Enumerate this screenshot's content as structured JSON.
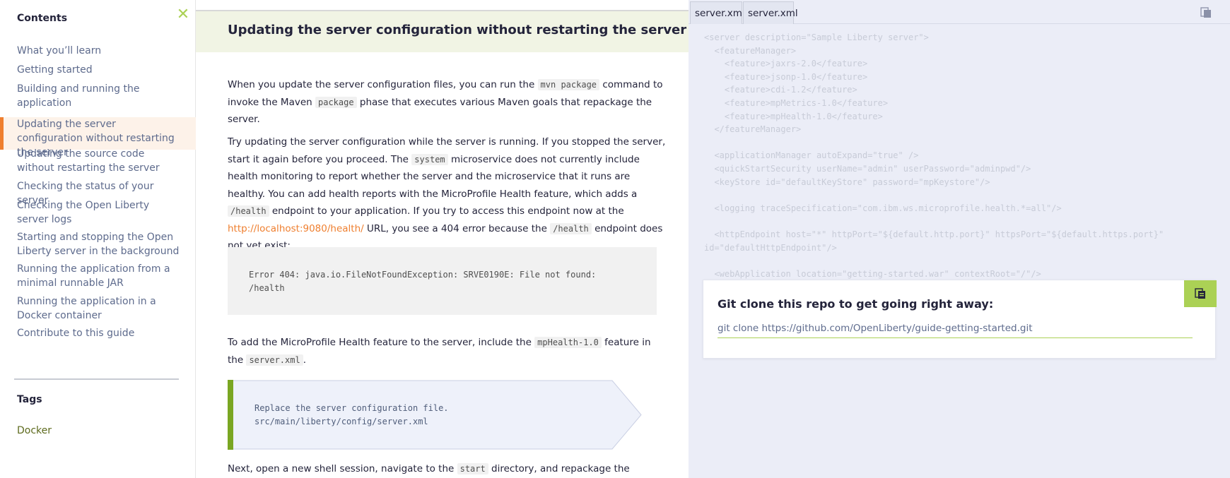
{
  "sidebar": {
    "title": "Contents",
    "toc": [
      {
        "label": "What you’ll learn"
      },
      {
        "label": "Getting started"
      },
      {
        "label": "Building and running the application"
      },
      {
        "label": "Updating the server configuration without restarting the server"
      },
      {
        "label": "Updating the source code without restarting the server"
      },
      {
        "label": "Checking the status of your server"
      },
      {
        "label": "Checking the Open Liberty server logs"
      },
      {
        "label": "Starting and stopping the Open Liberty server in the background"
      },
      {
        "label": "Running the application from a minimal runnable JAR"
      },
      {
        "label": "Running the application in a Docker container"
      },
      {
        "label": "Contribute to this guide"
      }
    ],
    "active_index": 3,
    "tags_title": "Tags",
    "tags": [
      "Docker"
    ]
  },
  "main": {
    "section_title": "Updating the server configuration without restarting the server",
    "p1": {
      "t1": "When you update the server configuration files, you can run the ",
      "c1": "mvn package",
      "t2": " command to invoke the Maven ",
      "c2": "package",
      "t3": " phase that executes various Maven goals that repackage the server."
    },
    "p2": {
      "t1": "Try updating the server configuration while the server is running. If you stopped the server, start it again before you proceed. The ",
      "c1": "system",
      "t2": " microservice does not currently include health monitoring to report whether the server and the microservice that it runs are healthy. You can add health reports with the MicroProfile Health feature, which adds a ",
      "c2": "/health",
      "t3": " endpoint to your application. If you try to access this endpoint now at the ",
      "link": "http://localhost:9080/health/",
      "t4": " URL, you see a 404 error because the ",
      "c3": "/health",
      "t5": " endpoint does not yet exist:"
    },
    "error_code": "Error 404: java.io.FileNotFoundException: SRVE0190E: File not found:\n/health",
    "p3": {
      "t1": "To add the MicroProfile Health feature to the server, include the ",
      "c1": "mpHealth-1.0",
      "t2": " feature in the ",
      "c2": "server.xml",
      "t3": "."
    },
    "action_text": "Replace the server configuration file.\nsrc/main/liberty/config/server.xml",
    "p4": {
      "t1": "Next, open a new shell session, navigate to the ",
      "c1": "start",
      "t2": " directory, and repackage the server:"
    }
  },
  "right": {
    "tabs": [
      "server.xml",
      "server.xml"
    ],
    "xml": "<server description=\"Sample Liberty server\">\n  <featureManager>\n    <feature>jaxrs-2.0</feature>\n    <feature>jsonp-1.0</feature>\n    <feature>cdi-1.2</feature>\n    <feature>mpMetrics-1.0</feature>\n    <feature>mpHealth-1.0</feature>\n  </featureManager>\n\n  <applicationManager autoExpand=\"true\" />\n  <quickStartSecurity userName=\"admin\" userPassword=\"adminpwd\"/>\n  <keyStore id=\"defaultKeyStore\" password=\"mpKeystore\"/>\n\n  <logging traceSpecification=\"com.ibm.ws.microprofile.health.*=all\"/>\n\n  <httpEndpoint host=\"*\" httpPort=\"${default.http.port}\" httpsPort=\"${default.https.port}\"\nid=\"defaultHttpEndpoint\"/>\n\n  <webApplication location=\"getting-started.war\" contextRoot=\"/\"/>",
    "clone_title": "Git clone this repo to get going right away:",
    "clone_cmd": "git clone https://github.com/OpenLiberty/guide-getting-started.git"
  },
  "colors": {
    "accent_orange": "#ef7f2f",
    "accent_green": "#abd155",
    "panel_bg": "#ebedf7"
  }
}
